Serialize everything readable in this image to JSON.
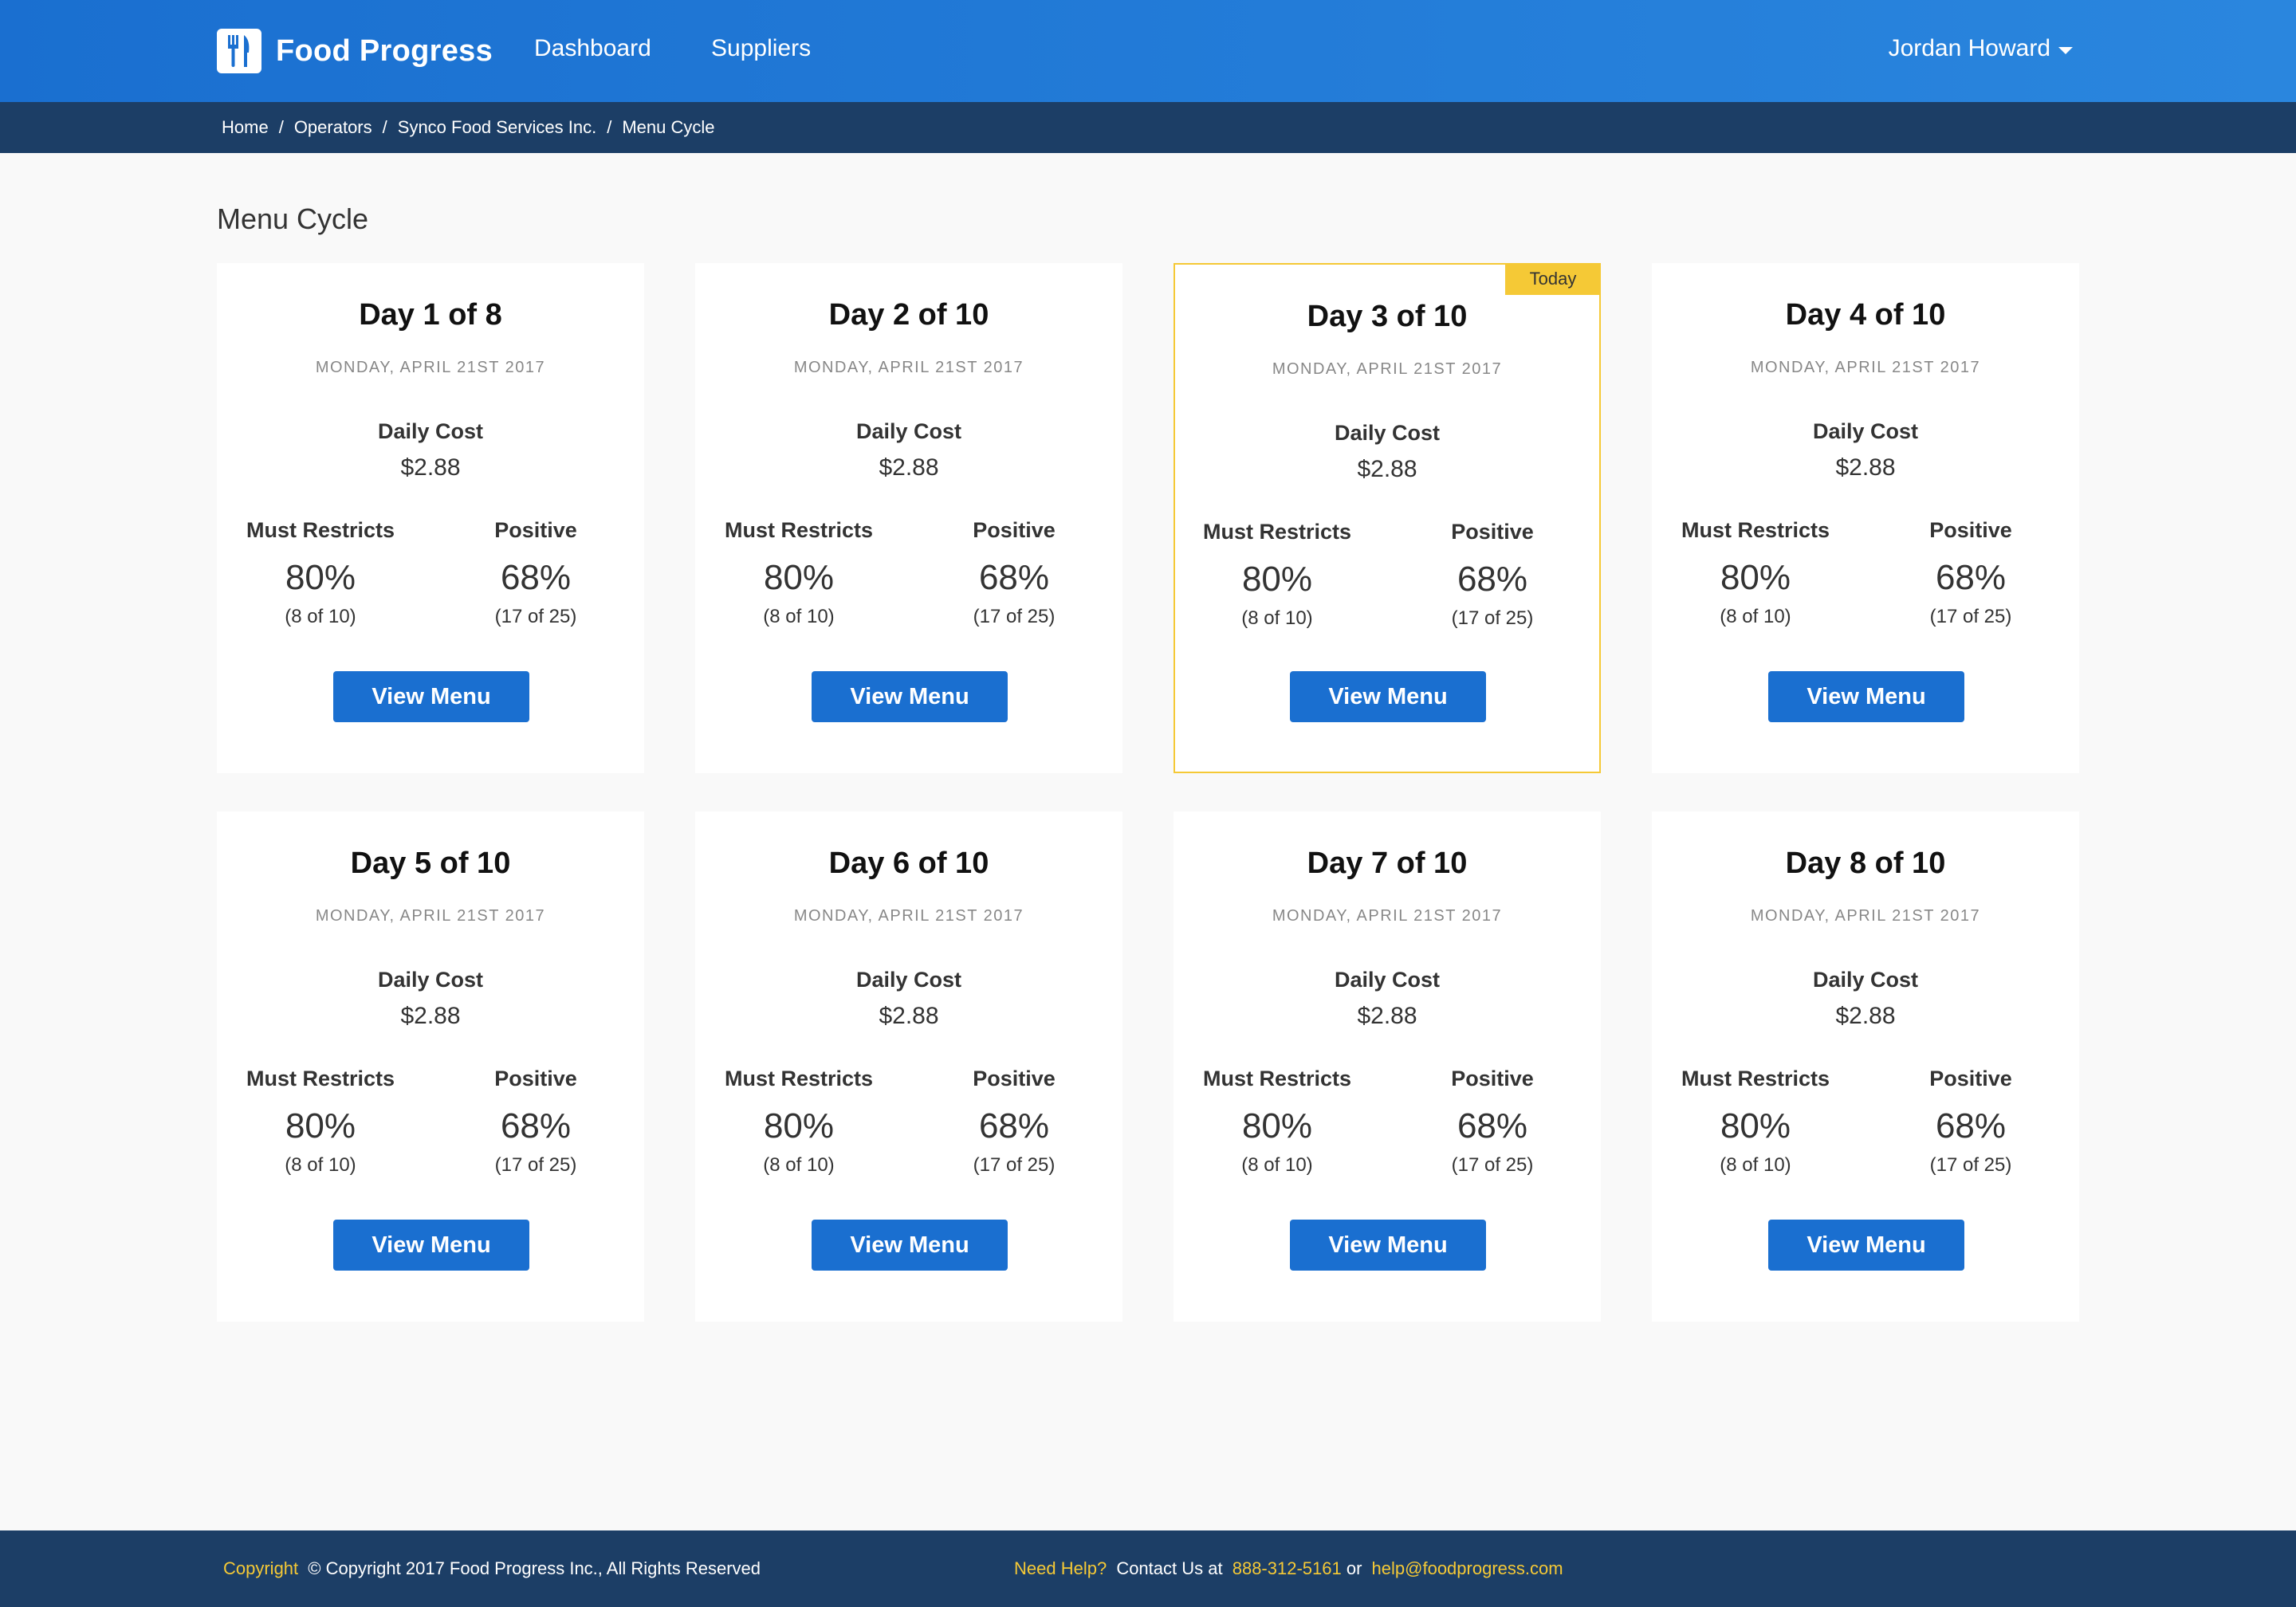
{
  "app": {
    "brand": "Food Progress",
    "nav": [
      "Dashboard",
      "Suppliers"
    ],
    "user": "Jordan Howard"
  },
  "breadcrumb": [
    "Home",
    "Operators",
    "Synco Food Services Inc.",
    "Menu Cycle"
  ],
  "page": {
    "title": "Menu Cycle"
  },
  "cards": [
    {
      "title": "Day 1 of 8",
      "date": "MONDAY, APRIL 21ST 2017",
      "cost_label": "Daily Cost",
      "cost": "$2.88",
      "must_label": "Must Restricts",
      "must_value": "80%",
      "must_sub": "(8 of 10)",
      "pos_label": "Positive",
      "pos_value": "68%",
      "pos_sub": "(17 of 25)",
      "button": "View Menu",
      "badge": ""
    },
    {
      "title": "Day 2 of 10",
      "date": "MONDAY, APRIL 21ST 2017",
      "cost_label": "Daily Cost",
      "cost": "$2.88",
      "must_label": "Must Restricts",
      "must_value": "80%",
      "must_sub": "(8 of 10)",
      "pos_label": "Positive",
      "pos_value": "68%",
      "pos_sub": "(17 of 25)",
      "button": "View Menu",
      "badge": ""
    },
    {
      "title": "Day 3 of 10",
      "date": "MONDAY, APRIL 21ST 2017",
      "cost_label": "Daily Cost",
      "cost": "$2.88",
      "must_label": "Must Restricts",
      "must_value": "80%",
      "must_sub": "(8 of 10)",
      "pos_label": "Positive",
      "pos_value": "68%",
      "pos_sub": "(17 of 25)",
      "button": "View Menu",
      "badge": "Today"
    },
    {
      "title": "Day 4 of 10",
      "date": "MONDAY, APRIL 21ST 2017",
      "cost_label": "Daily Cost",
      "cost": "$2.88",
      "must_label": "Must Restricts",
      "must_value": "80%",
      "must_sub": "(8 of 10)",
      "pos_label": "Positive",
      "pos_value": "68%",
      "pos_sub": "(17 of 25)",
      "button": "View Menu",
      "badge": ""
    },
    {
      "title": "Day 5 of 10",
      "date": "MONDAY, APRIL 21ST 2017",
      "cost_label": "Daily Cost",
      "cost": "$2.88",
      "must_label": "Must Restricts",
      "must_value": "80%",
      "must_sub": "(8 of 10)",
      "pos_label": "Positive",
      "pos_value": "68%",
      "pos_sub": "(17 of 25)",
      "button": "View Menu",
      "badge": ""
    },
    {
      "title": "Day 6 of 10",
      "date": "MONDAY, APRIL 21ST 2017",
      "cost_label": "Daily Cost",
      "cost": "$2.88",
      "must_label": "Must Restricts",
      "must_value": "80%",
      "must_sub": "(8 of 10)",
      "pos_label": "Positive",
      "pos_value": "68%",
      "pos_sub": "(17 of 25)",
      "button": "View Menu",
      "badge": ""
    },
    {
      "title": "Day 7 of 10",
      "date": "MONDAY, APRIL 21ST 2017",
      "cost_label": "Daily Cost",
      "cost": "$2.88",
      "must_label": "Must Restricts",
      "must_value": "80%",
      "must_sub": "(8 of 10)",
      "pos_label": "Positive",
      "pos_value": "68%",
      "pos_sub": "(17 of 25)",
      "button": "View Menu",
      "badge": ""
    },
    {
      "title": "Day 8 of 10",
      "date": "MONDAY, APRIL 21ST 2017",
      "cost_label": "Daily Cost",
      "cost": "$2.88",
      "must_label": "Must Restricts",
      "must_value": "80%",
      "must_sub": "(8 of 10)",
      "pos_label": "Positive",
      "pos_value": "68%",
      "pos_sub": "(17 of 25)",
      "button": "View Menu",
      "badge": ""
    }
  ],
  "footer": {
    "copyright_label": "Copyright",
    "copyright_text": "© Copyright 2017 Food Progress Inc., All Rights Reserved",
    "help_label": "Need Help?",
    "contact_text": "Contact Us at",
    "phone": "888-312-5161",
    "or_text": "or",
    "email": "help@foodprogress.com"
  },
  "colors": {
    "nav_blue": "#1a6fd0",
    "breadcrumb_navy": "#1c3e66",
    "today_yellow": "#f5c936",
    "button_blue": "#1a6fd0"
  },
  "icons": {
    "logo": "fork-knife-icon",
    "user_caret": "caret-down-icon"
  }
}
